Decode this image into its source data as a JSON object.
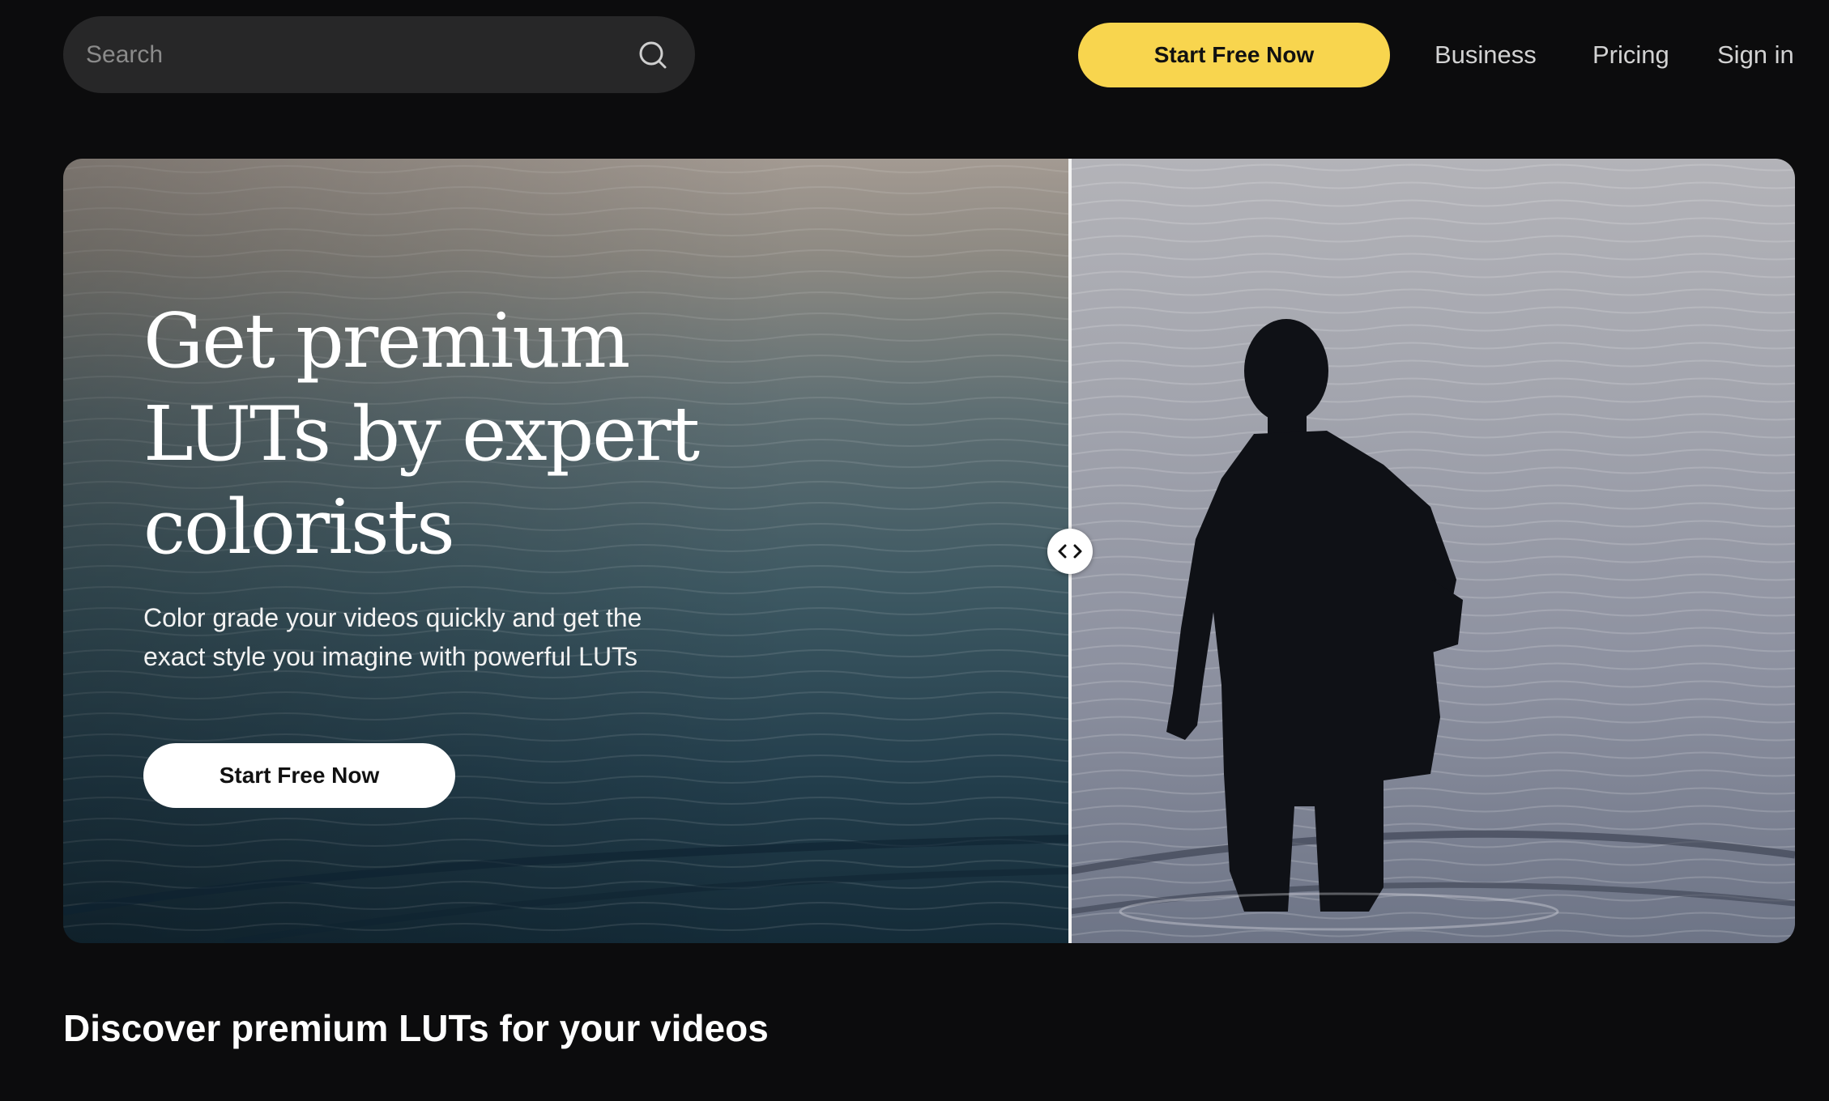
{
  "search": {
    "placeholder": "Search",
    "icon": "search-icon"
  },
  "header": {
    "cta_label": "Start Free Now",
    "cta_color": "#f8d54e",
    "nav": [
      "Business",
      "Pricing",
      "Sign in"
    ]
  },
  "hero": {
    "title": "Get premium LUTs by expert colorists",
    "subtitle": "Color grade your videos quickly and get the exact style you imagine with powerful LUTs",
    "cta_label": "Start Free Now",
    "comparison_split": 0.58,
    "handle_icon": "chevrons-left-right-icon"
  },
  "section": {
    "title": "Discover premium LUTs for your videos"
  }
}
